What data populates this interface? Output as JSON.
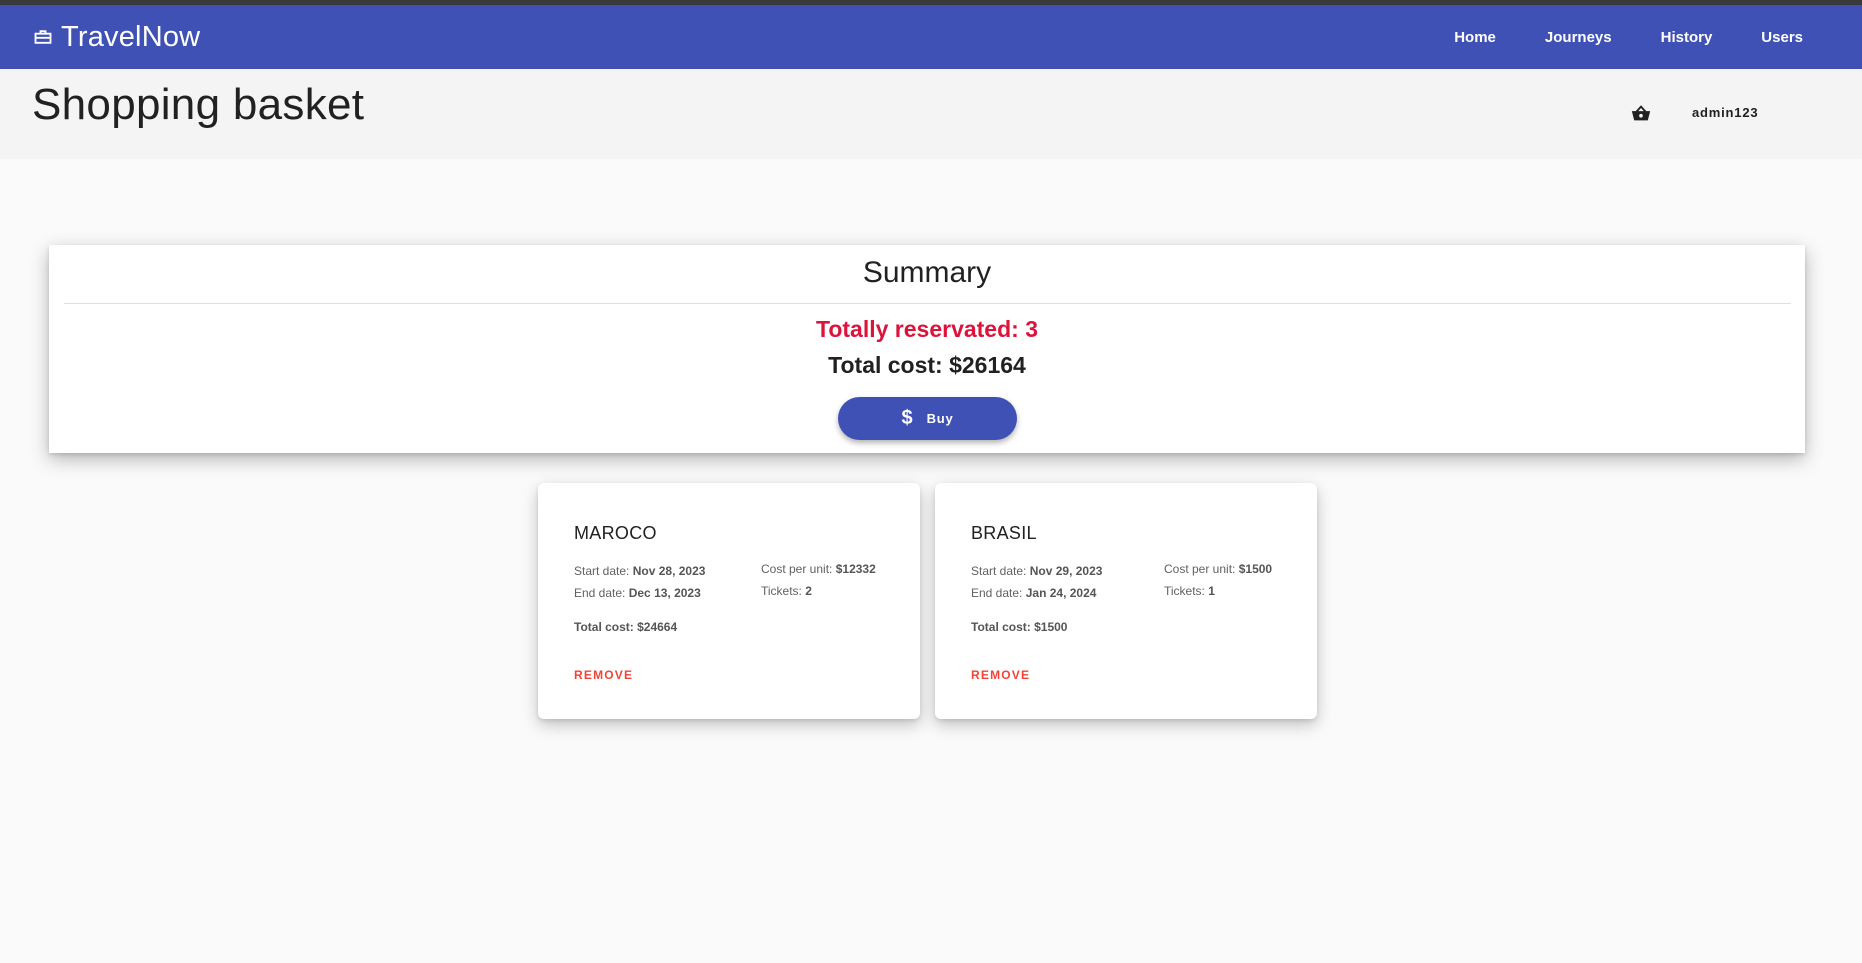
{
  "app": {
    "brand": "TravelNow",
    "brand_icon": "briefcase-icon",
    "accent_color": "#3f51b5",
    "nav": [
      {
        "label": "Home"
      },
      {
        "label": "Journeys"
      },
      {
        "label": "History"
      },
      {
        "label": "Users"
      }
    ]
  },
  "header": {
    "title": "Shopping basket",
    "basket_icon": "basket-icon",
    "user": "admin123"
  },
  "summary": {
    "title": "Summary",
    "reserved": "Totally reservated: 3",
    "reserved_color": "#dc143c",
    "total": "Total cost: $26164",
    "buy_label": "Buy",
    "buy_icon": "dollar-icon"
  },
  "labels": {
    "start_date": "Start date:",
    "end_date": "End date:",
    "cost_per_unit": "Cost per unit:",
    "tickets": "Tickets:",
    "remove": "REMOVE",
    "remove_color": "#f44336"
  },
  "cards": [
    {
      "title": "MAROCO",
      "start_date": "Nov 28, 2023",
      "end_date": "Dec 13, 2023",
      "cost_per_unit": "$12332",
      "tickets": "2",
      "total": "Total cost: $24664"
    },
    {
      "title": "BRASIL",
      "start_date": "Nov 29, 2023",
      "end_date": "Jan 24, 2024",
      "cost_per_unit": "$1500",
      "tickets": "1",
      "total": "Total cost: $1500"
    }
  ]
}
